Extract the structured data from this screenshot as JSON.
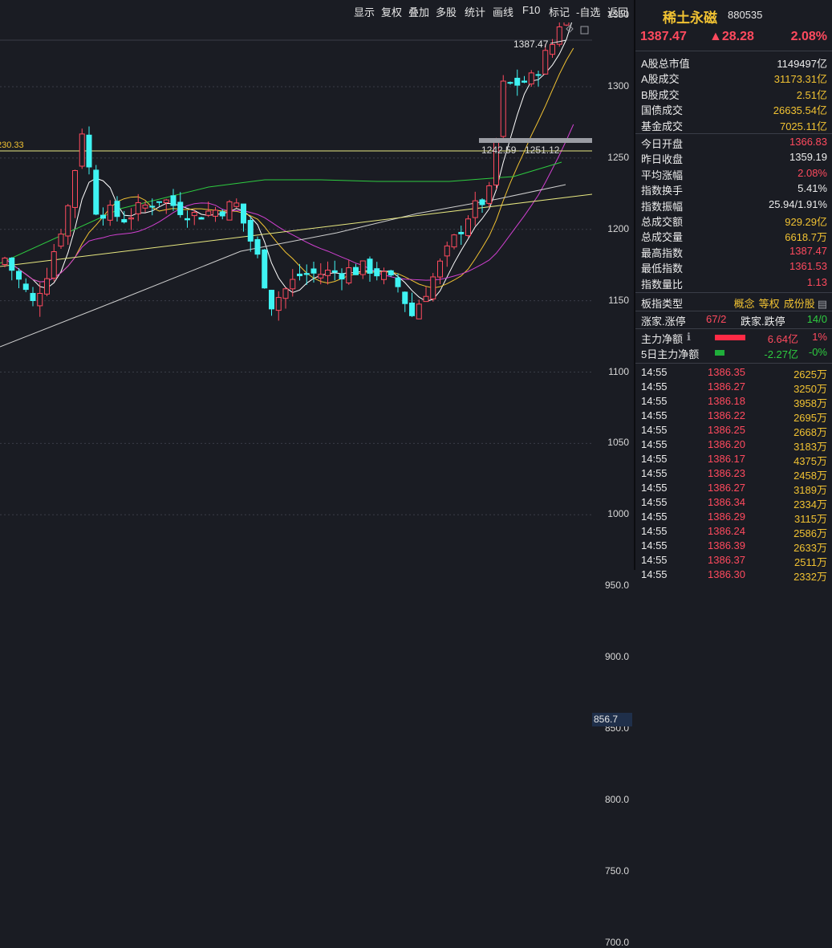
{
  "toolbar": {
    "buttons": [
      "显示",
      "复权",
      "叠加",
      "多股",
      "统计",
      "画线",
      "F10",
      "标记",
      "-自选",
      "返回"
    ]
  },
  "header": {
    "name": "稀土永磁",
    "code": "880535",
    "price": "1387.47",
    "change": "▲28.28",
    "change_pct": "2.08%"
  },
  "chart": {
    "last_price_label": "1387.47",
    "range_label": "1242.59 - 1251.12",
    "hline_label": "230.33",
    "current_marker": "856.7",
    "axis_ticks": [
      "1350",
      "1300",
      "1250",
      "1200",
      "1150",
      "1100",
      "1050",
      "1000",
      "950.0",
      "900.0",
      "850.0",
      "800.0",
      "750.0",
      "700.0"
    ],
    "colors": {
      "up": "#ff4a5e",
      "down": "#3ff3f3",
      "ma5": "#ffffff",
      "ma10": "#f1c232",
      "ma20": "#d040d0",
      "ma60": "#2ecc40",
      "ma250": "#cfcfcf",
      "trend": "#e8e880"
    }
  },
  "stats": [
    {
      "k": "A股总市值",
      "v": "1149497亿",
      "c": "wht"
    },
    {
      "k": "A股成交",
      "v": "31173.31亿",
      "c": "yel"
    },
    {
      "k": "B股成交",
      "v": "2.51亿",
      "c": "yel"
    },
    {
      "k": "国债成交",
      "v": "26635.54亿",
      "c": "yel"
    },
    {
      "k": "基金成交",
      "v": "7025.11亿",
      "c": "yel"
    },
    {
      "k": "今日开盘",
      "v": "1366.83",
      "c": "red"
    },
    {
      "k": "昨日收盘",
      "v": "1359.19",
      "c": "wht"
    },
    {
      "k": "平均涨幅",
      "v": "2.08%",
      "c": "red"
    },
    {
      "k": "指数换手",
      "v": "5.41%",
      "c": "wht"
    },
    {
      "k": "指数振幅",
      "v": "25.94/1.91%",
      "c": "wht"
    },
    {
      "k": "总成交额",
      "v": "929.29亿",
      "c": "yel"
    },
    {
      "k": "总成交量",
      "v": "6618.7万",
      "c": "yel"
    },
    {
      "k": "最高指数",
      "v": "1387.47",
      "c": "red"
    },
    {
      "k": "最低指数",
      "v": "1361.53",
      "c": "red"
    },
    {
      "k": "指数量比",
      "v": "1.13",
      "c": "red"
    }
  ],
  "board": {
    "label": "板指类型",
    "tags": [
      "概念",
      "等权",
      "成份股"
    ]
  },
  "limits": {
    "up_label": "涨家.涨停",
    "up_value": "67/2",
    "down_label": "跌家.跌停",
    "down_value": "14/0"
  },
  "flow": [
    {
      "label": "主力净额",
      "value": "6.64亿",
      "pct": "1%",
      "color": "red"
    },
    {
      "label": "5日主力净额",
      "value": "-2.27亿",
      "pct": "-0%",
      "color": "grn"
    }
  ],
  "ticks": [
    {
      "t": "14:55",
      "p": "1386.35",
      "q": "2625万"
    },
    {
      "t": "14:55",
      "p": "1386.27",
      "q": "3250万"
    },
    {
      "t": "14:55",
      "p": "1386.18",
      "q": "3958万"
    },
    {
      "t": "14:55",
      "p": "1386.22",
      "q": "2695万"
    },
    {
      "t": "14:55",
      "p": "1386.25",
      "q": "2668万"
    },
    {
      "t": "14:55",
      "p": "1386.20",
      "q": "3183万"
    },
    {
      "t": "14:55",
      "p": "1386.17",
      "q": "4375万"
    },
    {
      "t": "14:55",
      "p": "1386.23",
      "q": "2458万"
    },
    {
      "t": "14:55",
      "p": "1386.27",
      "q": "3189万"
    },
    {
      "t": "14:55",
      "p": "1386.34",
      "q": "2334万"
    },
    {
      "t": "14:55",
      "p": "1386.29",
      "q": "3115万"
    },
    {
      "t": "14:55",
      "p": "1386.24",
      "q": "2586万"
    },
    {
      "t": "14:55",
      "p": "1386.39",
      "q": "2633万"
    },
    {
      "t": "14:55",
      "p": "1386.37",
      "q": "2511万"
    },
    {
      "t": "14:55",
      "p": "1386.30",
      "q": "2332万"
    }
  ]
}
